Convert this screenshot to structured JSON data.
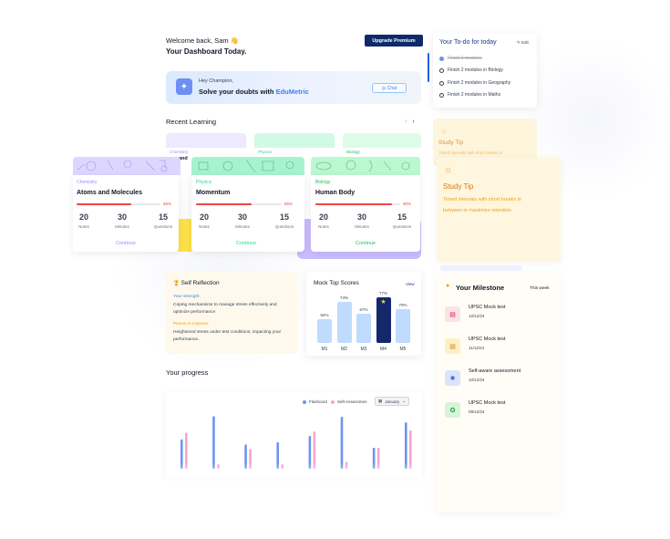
{
  "header": {
    "welcome": "Welcome back, Sam 👋",
    "title": "Your Dashboard Today.",
    "upgrade_label": "Upgrade Premium"
  },
  "banner": {
    "greeting": "Hey Champion,",
    "headline": "Solve your doubts with ",
    "brand": "EduMetric",
    "chat_label": "◎ Chat"
  },
  "recent": {
    "title": "Recent Learning",
    "prev": "‹",
    "next": "›",
    "back_labels": [
      "Chemistry",
      "Physics",
      "Biology"
    ],
    "peek_text": "ns and",
    "cards": [
      {
        "subject": "Chemistry",
        "title": "Atoms and Molecules",
        "percent": "65%",
        "progress": 0.65,
        "notes": "20",
        "minutes": "30",
        "questions": "15",
        "continue": "Continue",
        "accent": "#a78bfa",
        "pattern": "#ddd6fe"
      },
      {
        "subject": "Physics",
        "title": "Momentum",
        "percent": "65%",
        "progress": 0.65,
        "notes": "20",
        "minutes": "30",
        "questions": "15",
        "continue": "Continue",
        "accent": "#34d399",
        "pattern": "#a7f3d0"
      },
      {
        "subject": "Biology",
        "title": "Human Body",
        "percent": "90%",
        "progress": 0.9,
        "notes": "20",
        "minutes": "30",
        "questions": "15",
        "continue": "Continue",
        "accent": "#22c55e",
        "pattern": "#bbf7d0"
      }
    ],
    "stat_labels": {
      "notes": "Notes",
      "minutes": "Minutes",
      "questions": "Questions"
    }
  },
  "todo": {
    "title": "Your To-do for today",
    "edit_label": "✎ Edit",
    "items": [
      {
        "label": "Finish 2 modules",
        "done": true
      },
      {
        "label": "Finish 2 modules in Biology",
        "done": false
      },
      {
        "label": "Finish 2 modules in Geography",
        "done": false
      },
      {
        "label": "Finish 2 modules in Maths",
        "done": false
      }
    ]
  },
  "study_tip": {
    "title": "Study Tip",
    "back_text": "Timed intervals with short breaks in",
    "line1": "Timed intervals with short breaks in",
    "line2": "between to maximize retention."
  },
  "reflection": {
    "title": "Self Reflection",
    "icon": "🏆",
    "strength_label": "Your strength:",
    "strength_text": "Coping mechanisms to manage stress effectively and optimize performance",
    "improve_label": "Places to improve:",
    "improve_text": "Heightened stress under test conditions, impacting your performance.."
  },
  "mock": {
    "title": "Mock Top Scores",
    "view_label": "View",
    "highlight_color": "#14286b",
    "bar_color": "#bfdbfe",
    "scores": [
      {
        "label": "M1",
        "value": 64,
        "text": "64%"
      },
      {
        "label": "M2",
        "value": 74,
        "text": "74%"
      },
      {
        "label": "M3",
        "value": 67,
        "text": "67%"
      },
      {
        "label": "M4",
        "value": 77,
        "text": "77%",
        "best": true
      },
      {
        "label": "M5",
        "value": 70,
        "text": "70%"
      }
    ]
  },
  "milestone": {
    "title": "Your Milestone",
    "period": "This week",
    "items": [
      {
        "name": "UPSC Mock test",
        "date": "12/12/24",
        "bg": "#fde2e7",
        "fg": "#e11d48",
        "icon": "file-icon"
      },
      {
        "name": "UPSC Mock test",
        "date": "11/12/24",
        "bg": "#fdefc7",
        "fg": "#d97706",
        "icon": "file-icon"
      },
      {
        "name": "Self-aware assessment",
        "date": "10/12/24",
        "bg": "#dbe4fb",
        "fg": "#3b5bdb",
        "icon": "bulb-icon"
      },
      {
        "name": "UPSC Mock test",
        "date": "09/12/24",
        "bg": "#d7f5d9",
        "fg": "#16a34a",
        "icon": "medal-icon"
      }
    ]
  },
  "progress": {
    "title": "Your progress",
    "legend": [
      {
        "name": "Flashcard",
        "color": "#6d95f0"
      },
      {
        "name": "Self-Assessmen",
        "color": "#f6a5cf"
      }
    ],
    "month": "January"
  },
  "chart_data": {
    "type": "bar",
    "series": [
      {
        "name": "Flashcard",
        "values": [
          0.52,
          0.93,
          0.43,
          0.47,
          0.58,
          0.92,
          0.37,
          0.82
        ]
      },
      {
        "name": "Self-Assessmen",
        "values": [
          0.64,
          0.08,
          0.35,
          0.08,
          0.66,
          0.12,
          0.37,
          0.68
        ]
      }
    ]
  }
}
